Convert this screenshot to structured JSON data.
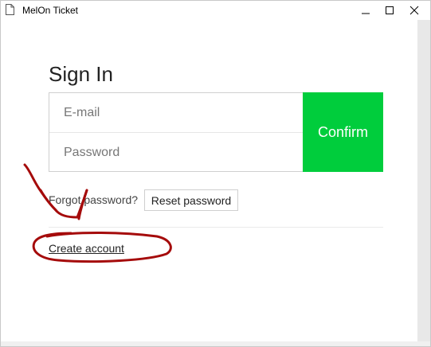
{
  "window": {
    "title": "MelOn Ticket",
    "icon": "document-icon",
    "controls": [
      "minimize-icon",
      "maximize-icon",
      "close-icon"
    ]
  },
  "signin": {
    "heading": "Sign In",
    "email_placeholder": "E-mail",
    "password_placeholder": "Password",
    "confirm_label": "Confirm",
    "forgot_text": "Forgot password?",
    "reset_label": "Reset password",
    "create_account_label": "Create account"
  },
  "colors": {
    "confirm_bg": "#00cd3c",
    "annotation_ink": "#a50b0b"
  }
}
